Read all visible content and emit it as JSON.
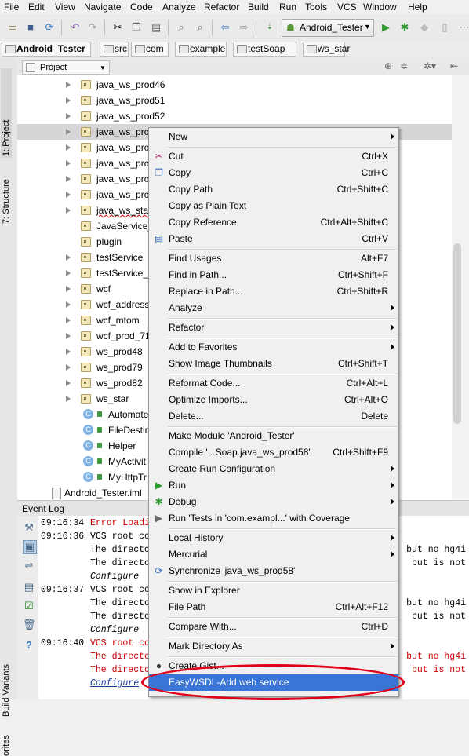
{
  "menubar": [
    "File",
    "Edit",
    "View",
    "Navigate",
    "Code",
    "Analyze",
    "Refactor",
    "Build",
    "Run",
    "Tools",
    "VCS",
    "Window",
    "Help"
  ],
  "toolbar": {
    "run_config": "Android_Tester"
  },
  "breadcrumbs": [
    "Android_Tester",
    "src",
    "com",
    "example",
    "testSoap",
    "ws_star"
  ],
  "side_tabs": {
    "project": "1: Project",
    "structure": "7: Structure",
    "build_variants": "Build Variants",
    "favorites": "orites"
  },
  "project_panel": {
    "selector": "Project"
  },
  "tree": [
    {
      "label": "java_ws_prod46",
      "kind": "package",
      "indent": 1
    },
    {
      "label": "java_ws_prod51",
      "kind": "package",
      "indent": 1
    },
    {
      "label": "java_ws_prod52",
      "kind": "package",
      "indent": 1
    },
    {
      "label": "java_ws_proc",
      "kind": "package",
      "indent": 1,
      "selected": true
    },
    {
      "label": "java_ws_proc",
      "kind": "package",
      "indent": 1
    },
    {
      "label": "java_ws_proc",
      "kind": "package",
      "indent": 1
    },
    {
      "label": "java_ws_proc",
      "kind": "package",
      "indent": 1
    },
    {
      "label": "java_ws_proc",
      "kind": "package",
      "indent": 1
    },
    {
      "label": "java_ws_star",
      "kind": "package",
      "indent": 1
    },
    {
      "label": "JavaService_F",
      "kind": "package-noarrow",
      "indent": 1
    },
    {
      "label": "plugin",
      "kind": "package-noarrow",
      "indent": 1
    },
    {
      "label": "testService",
      "kind": "package",
      "indent": 1
    },
    {
      "label": "testService_d",
      "kind": "package",
      "indent": 1
    },
    {
      "label": "wcf",
      "kind": "package",
      "indent": 1
    },
    {
      "label": "wcf_addressi",
      "kind": "package",
      "indent": 1
    },
    {
      "label": "wcf_mtom",
      "kind": "package",
      "indent": 1
    },
    {
      "label": "wcf_prod_71",
      "kind": "package",
      "indent": 1
    },
    {
      "label": "ws_prod48",
      "kind": "package",
      "indent": 1
    },
    {
      "label": "ws_prod79",
      "kind": "package",
      "indent": 1
    },
    {
      "label": "ws_prod82",
      "kind": "package",
      "indent": 1
    },
    {
      "label": "ws_star",
      "kind": "package",
      "indent": 1
    },
    {
      "label": "Automate",
      "kind": "class",
      "indent": 2
    },
    {
      "label": "FileDestin",
      "kind": "class",
      "indent": 2
    },
    {
      "label": "Helper",
      "kind": "class",
      "indent": 2
    },
    {
      "label": "MyActivit",
      "kind": "class",
      "indent": 2
    },
    {
      "label": "MyHttpTr",
      "kind": "class",
      "indent": 2
    },
    {
      "label": "Android_Tester.iml",
      "kind": "file",
      "indent": 0
    }
  ],
  "event_log": {
    "title": "Event Log",
    "lines": [
      {
        "time": "09:16:34",
        "text": "Error Loadi",
        "style": "error"
      },
      {
        "time": "09:16:36",
        "text": "VCS root co",
        "style": "normal"
      },
      {
        "time": "",
        "text": "The directo",
        "style": "normal",
        "right": ", but no hg4i"
      },
      {
        "time": "",
        "text": "The directo",
        "style": "normal",
        "right": "but is not"
      },
      {
        "time": "",
        "text": "Configure",
        "style": "italic"
      },
      {
        "time": "09:16:37",
        "text": "VCS root co",
        "style": "normal"
      },
      {
        "time": "",
        "text": "The directo",
        "style": "normal",
        "right": ", but no hg4i"
      },
      {
        "time": "",
        "text": "The directo",
        "style": "normal",
        "right": "but is not"
      },
      {
        "time": "",
        "text": "Configure",
        "style": "italic"
      },
      {
        "time": "09:16:40",
        "text": "VCS root co",
        "style": "error"
      },
      {
        "time": "",
        "text": "The directo",
        "style": "error",
        "right": ", but no hg4i"
      },
      {
        "time": "",
        "text": "The directo",
        "style": "error",
        "right": "but is not"
      },
      {
        "time": "",
        "text": "Configure",
        "style": "link"
      }
    ]
  },
  "context_menu": [
    {
      "label": "New",
      "submenu": true
    },
    {
      "sep": true
    },
    {
      "label": "Cut",
      "shortcut": "Ctrl+X",
      "icon": "scissors-icon"
    },
    {
      "label": "Copy",
      "shortcut": "Ctrl+C",
      "icon": "copy-icon"
    },
    {
      "label": "Copy Path",
      "shortcut": "Ctrl+Shift+C"
    },
    {
      "label": "Copy as Plain Text"
    },
    {
      "label": "Copy Reference",
      "shortcut": "Ctrl+Alt+Shift+C"
    },
    {
      "label": "Paste",
      "shortcut": "Ctrl+V",
      "icon": "paste-icon"
    },
    {
      "sep": true
    },
    {
      "label": "Find Usages",
      "shortcut": "Alt+F7"
    },
    {
      "label": "Find in Path...",
      "shortcut": "Ctrl+Shift+F"
    },
    {
      "label": "Replace in Path...",
      "shortcut": "Ctrl+Shift+R"
    },
    {
      "label": "Analyze",
      "submenu": true
    },
    {
      "sep": true
    },
    {
      "label": "Refactor",
      "submenu": true
    },
    {
      "sep": true
    },
    {
      "label": "Add to Favorites",
      "submenu": true
    },
    {
      "label": "Show Image Thumbnails",
      "shortcut": "Ctrl+Shift+T"
    },
    {
      "sep": true
    },
    {
      "label": "Reformat Code...",
      "shortcut": "Ctrl+Alt+L"
    },
    {
      "label": "Optimize Imports...",
      "shortcut": "Ctrl+Alt+O"
    },
    {
      "label": "Delete...",
      "shortcut": "Delete"
    },
    {
      "sep": true
    },
    {
      "label": "Make Module 'Android_Tester'"
    },
    {
      "label": "Compile '...Soap.java_ws_prod58'",
      "shortcut": "Ctrl+Shift+F9"
    },
    {
      "label": "Create Run Configuration",
      "submenu": true
    },
    {
      "label": "Run",
      "submenu": true,
      "icon": "run-icon"
    },
    {
      "label": "Debug",
      "submenu": true,
      "icon": "debug-icon"
    },
    {
      "label": "Run 'Tests in 'com.exampl...' with Coverage",
      "icon": "coverage-icon"
    },
    {
      "sep": true
    },
    {
      "label": "Local History",
      "submenu": true
    },
    {
      "label": "Mercurial",
      "submenu": true
    },
    {
      "label": "Synchronize 'java_ws_prod58'",
      "icon": "sync-icon"
    },
    {
      "sep": true
    },
    {
      "label": "Show in Explorer"
    },
    {
      "label": "File Path",
      "shortcut": "Ctrl+Alt+F12"
    },
    {
      "sep": true
    },
    {
      "label": "Compare With...",
      "shortcut": "Ctrl+D"
    },
    {
      "sep": true
    },
    {
      "label": "Mark Directory As",
      "submenu": true
    },
    {
      "sep": true
    },
    {
      "label": "Create Gist...",
      "icon": "github-icon"
    },
    {
      "label": "EasyWSDL-Add web service",
      "highlighted": true
    }
  ],
  "colors": {
    "highlight": "#3875d7",
    "annotation": "#e0001a",
    "error": "#cc0000"
  }
}
